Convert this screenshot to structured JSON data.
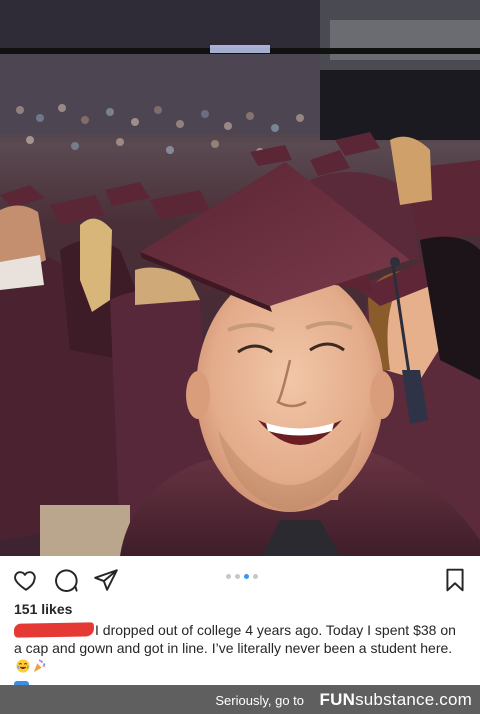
{
  "post": {
    "likes": "151 likes",
    "caption_text": "I dropped out of college 4 years ago. Today I spent $38 on a cap and gown and got in line. I’ve literally never been a student here.",
    "caption_arrow": "➡",
    "username_redacted": true
  },
  "icons": {
    "like": "heart-outline-icon",
    "comment": "comment-bubble-icon",
    "share": "paper-plane-icon",
    "save": "bookmark-icon"
  },
  "carousel": {
    "count": 4,
    "active_index": 2
  },
  "colors": {
    "gown": "#5a2a38",
    "redaction": "#e53935",
    "carousel_active": "#3897f0",
    "footer_bg": "#5f5f5f"
  },
  "footer": {
    "message": "Seriously, go to",
    "brand_part1": "FUN",
    "brand_part2": "substance",
    "brand_part3": ".com"
  }
}
